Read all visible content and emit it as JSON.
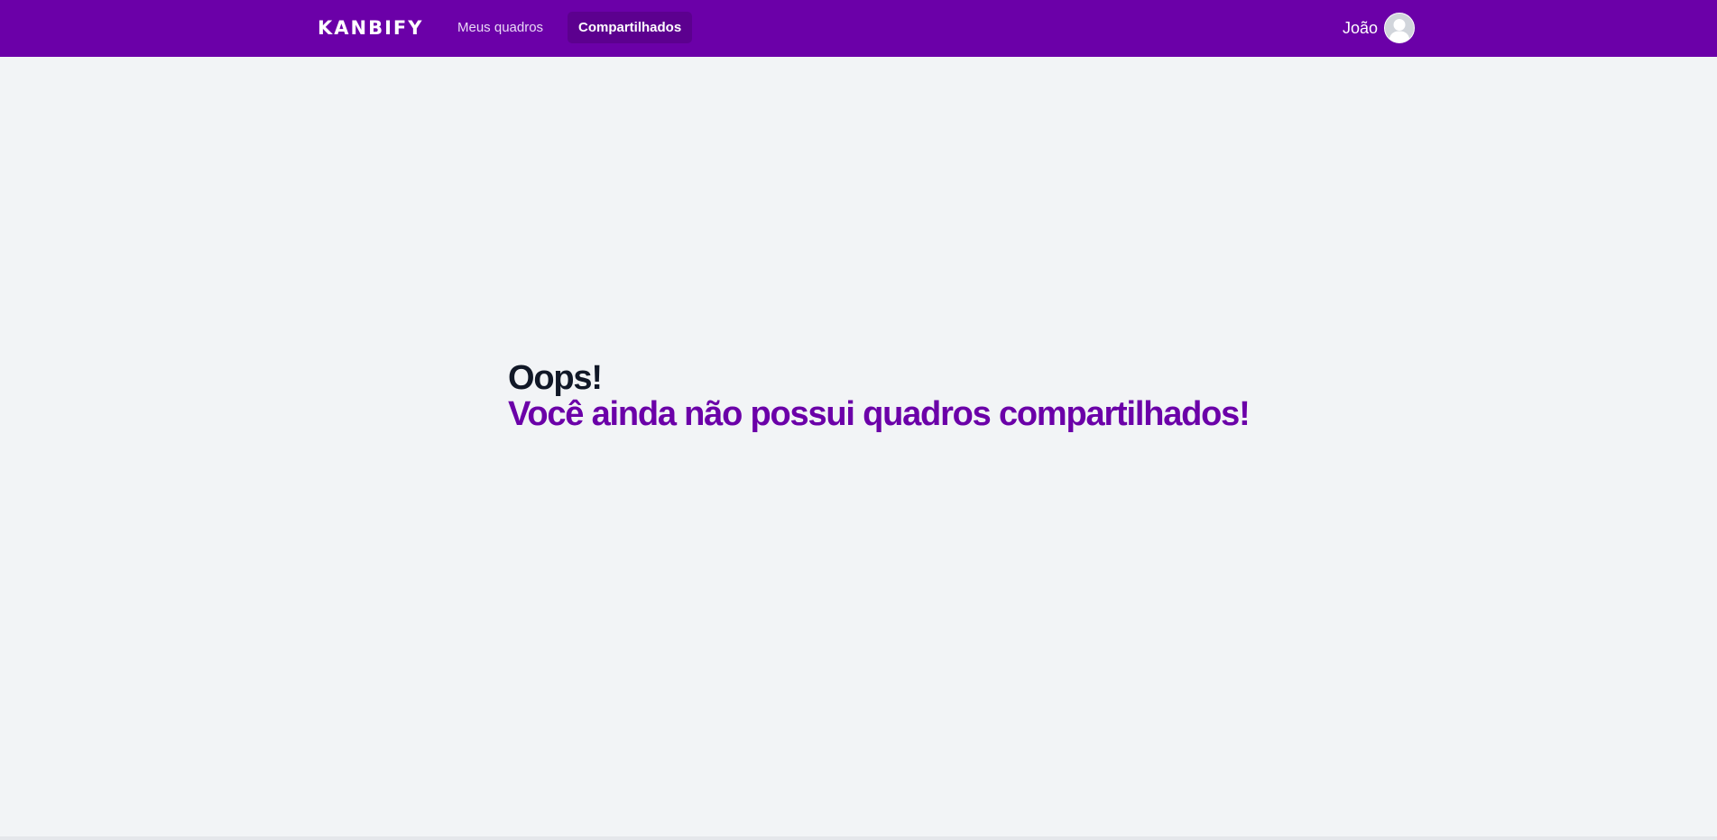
{
  "navbar": {
    "logo": "KANBIFY",
    "links": [
      {
        "label": "Meus quadros",
        "active": false
      },
      {
        "label": "Compartilhados",
        "active": true
      }
    ],
    "user": {
      "name": "João"
    }
  },
  "empty_state": {
    "title": "Oops!",
    "message": "Você ainda não possui quadros compartilhados!"
  },
  "colors": {
    "brand": "#6b00a8",
    "nav_active": "#5c008f",
    "background": "#f2f4f6",
    "heading": "#111827"
  }
}
